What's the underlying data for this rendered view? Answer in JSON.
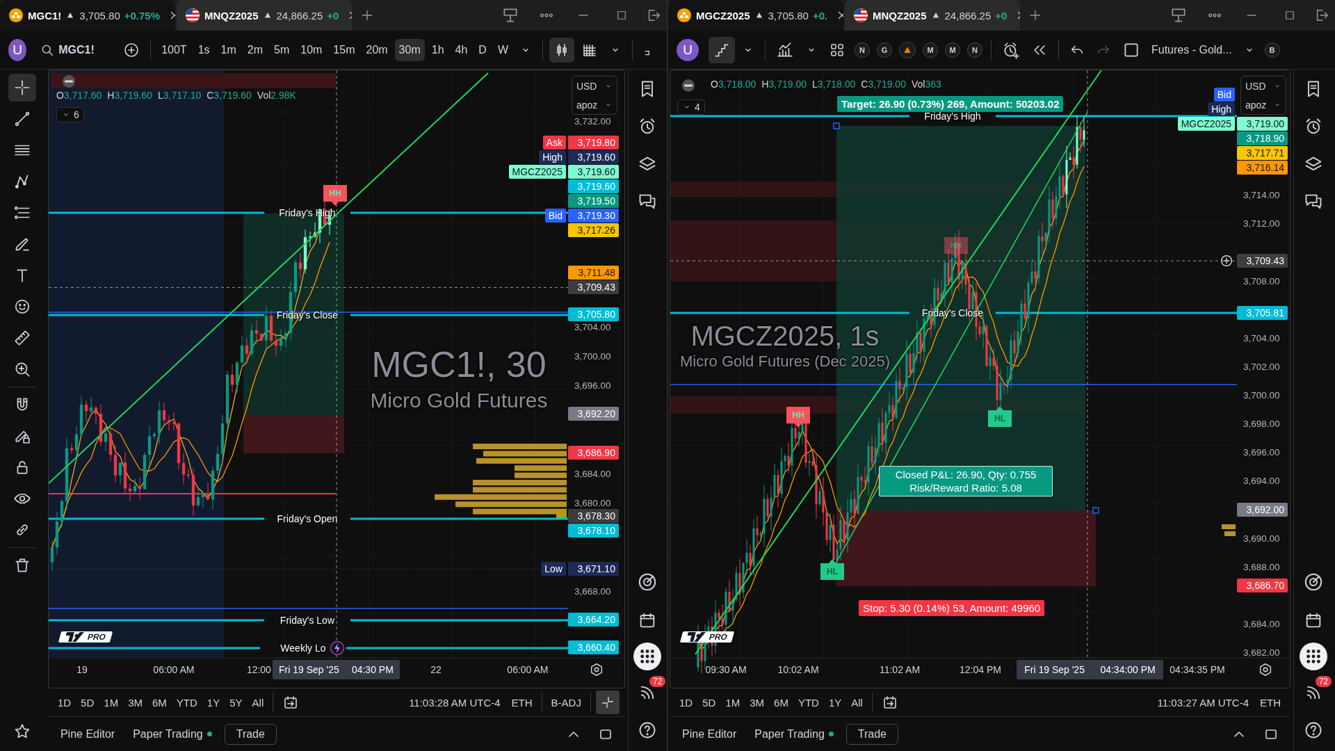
{
  "panes": [
    {
      "tabs": [
        {
          "symbol": "MGC1!",
          "price": "3,705.80",
          "change": "+0.75%",
          "selected": true
        },
        {
          "symbol": "MNQZ2025",
          "price": "24,866.25",
          "change": "+0",
          "selected": false
        }
      ],
      "toolbar": {
        "avatar": "U",
        "symbol": "MGC1!",
        "intervals": [
          {
            "label": "100T",
            "selected": false
          },
          {
            "label": "1s",
            "selected": false
          },
          {
            "label": "1m",
            "selected": false
          },
          {
            "label": "2m",
            "selected": false
          },
          {
            "label": "5m",
            "selected": false
          },
          {
            "label": "10m",
            "selected": false
          },
          {
            "label": "15m",
            "selected": false
          },
          {
            "label": "20m",
            "selected": false
          },
          {
            "label": "30m",
            "selected": true
          },
          {
            "label": "1h",
            "selected": false
          },
          {
            "label": "4h",
            "selected": false
          },
          {
            "label": "D",
            "selected": false
          },
          {
            "label": "W",
            "selected": false
          }
        ]
      },
      "legend": {
        "items": [
          {
            "key": "O",
            "value": "3,717.60"
          },
          {
            "key": "H",
            "value": "3,719.60"
          },
          {
            "key": "L",
            "value": "3,717.10"
          },
          {
            "key": "C",
            "value": "3,719.60"
          },
          {
            "key": "Vol",
            "value": "2.98K"
          }
        ],
        "indicators_count": "6"
      },
      "watermark": {
        "title": "MGC1!, 30",
        "subtitle": "Micro Gold Futures"
      },
      "currency": "USD",
      "scale_mode": "apoz",
      "ticks": [
        "3,732.00",
        "3,704.00",
        "3,700.00",
        "3,696.00",
        "3,684.00",
        "3,680.00",
        "3,668.00"
      ],
      "price_labels": [
        {
          "tag": "Ask",
          "value": "3,719.80",
          "color": "#f23645",
          "kind": "stack"
        },
        {
          "tag": "High",
          "value": "3,719.60",
          "color": "#1c2a57",
          "kind": "stack"
        },
        {
          "tag": "MGCZ2025",
          "value": "3,719.60",
          "color": "#7ffbd0",
          "kind": "stack"
        },
        {
          "value": "3,719.60",
          "color": "#00bcd4",
          "kind": "stack"
        },
        {
          "value": "3,719.50",
          "color": "#089981",
          "kind": "stack"
        },
        {
          "tag": "Bid",
          "value": "3,719.30",
          "color": "#2962ff",
          "kind": "stack"
        },
        {
          "value": "3,717.26",
          "color": "#f7c600",
          "kind": "stack"
        },
        {
          "value": "3,711.48",
          "color": "#ff9800",
          "kind": "level"
        },
        {
          "value": "3,709.43",
          "color": "#3d3d3d",
          "kind": "level"
        },
        {
          "value": "3,705.80",
          "color": "#00bcd4",
          "kind": "level"
        },
        {
          "value": "3,692.20",
          "color": "#787b86",
          "kind": "level"
        },
        {
          "value": "3,686.90",
          "color": "#f23645",
          "kind": "level"
        },
        {
          "value": "3,678.30",
          "color": "#3d3d3d",
          "kind": "level"
        },
        {
          "value": "3,678.10",
          "color": "#00bcd4",
          "kind": "level"
        },
        {
          "tag": "Low",
          "value": "3,671.10",
          "color": "#1c2a57",
          "kind": "level"
        },
        {
          "value": "3,664.20",
          "color": "#00bcd4",
          "kind": "level"
        },
        {
          "value": "3,660.40",
          "color": "#00bcd4",
          "kind": "level"
        }
      ],
      "level_lines": [
        {
          "label": "Friday's High"
        },
        {
          "label": "Friday's Close"
        },
        {
          "label": "Friday's Open"
        },
        {
          "label": "Friday's Low"
        },
        {
          "label": "Weekly Lo"
        }
      ],
      "markers": [
        {
          "text": "HH",
          "kind": "high",
          "faded": false
        }
      ],
      "logo": "PRO",
      "time_labels": [
        "19",
        "06:00 AM",
        "12:00",
        "22",
        "06:00 AM"
      ],
      "crosshair_time": [
        "Fri 19 Sep '25",
        "04:30 PM"
      ],
      "ranges": [
        "1D",
        "5D",
        "1M",
        "3M",
        "6M",
        "YTD",
        "1Y",
        "5Y",
        "All"
      ],
      "clock": "11:03:28 AM UTC-4",
      "session": "ETH",
      "adjustment": "B-ADJ",
      "footer": {
        "tabs": [
          "Pine Editor",
          "Paper Trading"
        ],
        "trade": "Trade"
      },
      "notifications": "72"
    },
    {
      "tabs": [
        {
          "symbol": "MGCZ2025",
          "price": "3,705.80",
          "change": "+0.",
          "selected": true
        },
        {
          "symbol": "MNQZ2025",
          "price": "24,866.25",
          "change": "+0",
          "selected": false
        }
      ],
      "toolbar": {
        "avatar": "U",
        "badges": [
          "N",
          "G",
          "M",
          "M",
          "N"
        ],
        "layout_name": "Futures - Gold...",
        "account": "B"
      },
      "legend": {
        "items": [
          {
            "key": "O",
            "value": "3,718.00"
          },
          {
            "key": "H",
            "value": "3,719.00"
          },
          {
            "key": "L",
            "value": "3,718.00"
          },
          {
            "key": "C",
            "value": "3,719.00"
          },
          {
            "key": "Vol",
            "value": "363"
          }
        ],
        "indicators_count": "4"
      },
      "watermark": {
        "title": "MGCZ2025, 1s",
        "subtitle": "Micro Gold Futures (Dec 2025)"
      },
      "currency": "USD",
      "scale_mode": "apoz",
      "floating_tags": [
        {
          "text": "Bid",
          "color": "#2962ff"
        },
        {
          "text": "High",
          "color": "#1c2a57"
        }
      ],
      "ticks": [
        "3,714.00",
        "3,712.00",
        "3,708.00",
        "3,704.00",
        "3,702.00",
        "3,700.00",
        "3,698.00",
        "3,696.00",
        "3,694.00",
        "3,690.00",
        "3,688.00",
        "3,684.00",
        "3,682.00"
      ],
      "price_labels": [
        {
          "tag": "MGCZ2025",
          "value": "3,719.00",
          "color": "#7ffbd0",
          "kind": "level"
        },
        {
          "value": "3,718.90",
          "color": "#089981",
          "kind": "level"
        },
        {
          "value": "3,717.71",
          "color": "#f7c600",
          "kind": "level"
        },
        {
          "value": "3,716.14",
          "color": "#ff9800",
          "kind": "level"
        },
        {
          "value": "3,709.43",
          "color": "#3d3d3d",
          "kind": "level"
        },
        {
          "value": "3,705.81",
          "color": "#00bcd4",
          "kind": "level"
        },
        {
          "value": "3,692.00",
          "color": "#787b86",
          "kind": "level"
        },
        {
          "value": "3,686.70",
          "color": "#f23645",
          "kind": "level"
        }
      ],
      "level_lines": [
        {
          "label": "Friday's High"
        },
        {
          "label": "Friday's Close"
        }
      ],
      "markers": [
        {
          "text": "HH",
          "kind": "high",
          "faded": true
        },
        {
          "text": "HH",
          "kind": "high",
          "faded": false
        },
        {
          "text": "HL",
          "kind": "low",
          "faded": false
        },
        {
          "text": "HL",
          "kind": "low",
          "faded": false
        }
      ],
      "position": {
        "target": "Target: 26.90 (0.73%) 269, Amount: 50203.02",
        "result": [
          "Closed P&L: 26.90, Qty: 0.755",
          "Risk/Reward Ratio: 5.08"
        ],
        "stop": "Stop: 5.30 (0.14%) 53, Amount: 49960"
      },
      "logo": "PRO",
      "time_labels": [
        "09:30 AM",
        "10:02 AM",
        "11:02 AM",
        "12:04 PM",
        "04:34:35 PM"
      ],
      "crosshair_time": [
        "Fri 19 Sep '25",
        "04:34:00 PM"
      ],
      "ranges": [
        "1D",
        "5D",
        "1M",
        "3M",
        "6M",
        "YTD",
        "1Y",
        "All"
      ],
      "clock": "11:03:27 AM UTC-4",
      "session": "ETH",
      "footer": {
        "tabs": [
          "Pine Editor",
          "Paper Trading"
        ],
        "trade": "Trade"
      },
      "notifications": "72"
    }
  ]
}
